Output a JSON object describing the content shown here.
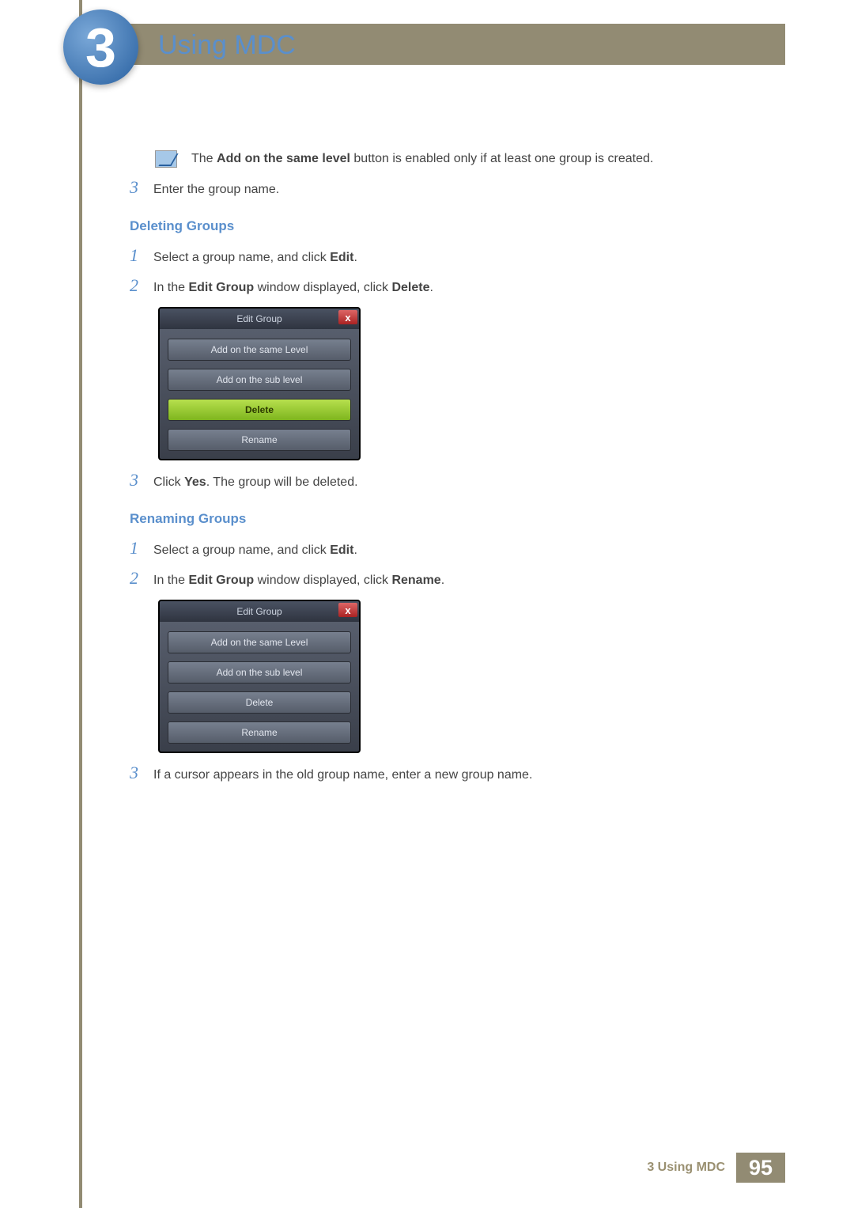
{
  "chapter": {
    "number": "3",
    "title": "Using MDC"
  },
  "note": {
    "pre": "The ",
    "bold": "Add on the same level",
    "post": " button is enabled only if at least one group is created."
  },
  "step3_top": "Enter the group name.",
  "deleting": {
    "heading": "Deleting Groups",
    "s1": {
      "pre": "Select a group name, and click ",
      "b": "Edit",
      "post": "."
    },
    "s2": {
      "pre": "In the ",
      "b1": "Edit Group",
      "mid": " window displayed, click ",
      "b2": "Delete",
      "post": "."
    },
    "s3": {
      "pre": "Click ",
      "b": "Yes",
      "post": ". The group will be deleted."
    }
  },
  "renaming": {
    "heading": "Renaming Groups",
    "s1": {
      "pre": "Select a group name, and click ",
      "b": "Edit",
      "post": "."
    },
    "s2": {
      "pre": "In the ",
      "b1": "Edit Group",
      "mid": " window displayed, click ",
      "b2": "Rename",
      "post": "."
    },
    "s3": "If a cursor appears in the old group name, enter a new group name."
  },
  "dialog": {
    "title": "Edit Group",
    "close": "x",
    "btn1": "Add on the same Level",
    "btn2": "Add on the sub level",
    "btn3": "Delete",
    "btn4": "Rename"
  },
  "footer": {
    "label": "3 Using MDC",
    "page": "95"
  },
  "nums": {
    "n1": "1",
    "n2": "2",
    "n3": "3"
  }
}
